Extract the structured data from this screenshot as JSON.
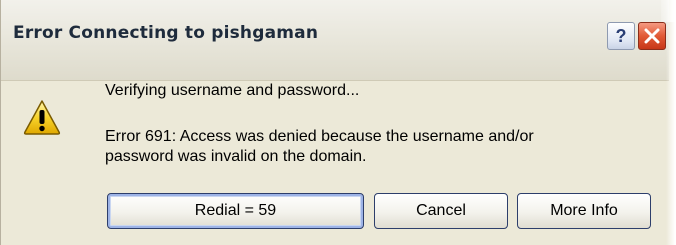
{
  "window": {
    "title": "Error Connecting to pishgaman",
    "help_glyph": "?",
    "icons": {
      "help": "help-icon",
      "close": "close-icon",
      "warning": "warning-icon"
    },
    "colors": {
      "close": "#e15a36",
      "warning_fill": "#f7d32b",
      "dialog_bg": "#ece9d8"
    }
  },
  "message": {
    "status": "Verifying username and password...",
    "error_line1": "Error 691: Access was denied because the username and/or",
    "error_line2": "password was invalid on the domain."
  },
  "buttons": {
    "redial": "Redial = 59",
    "cancel": "Cancel",
    "more_info": "More Info"
  }
}
